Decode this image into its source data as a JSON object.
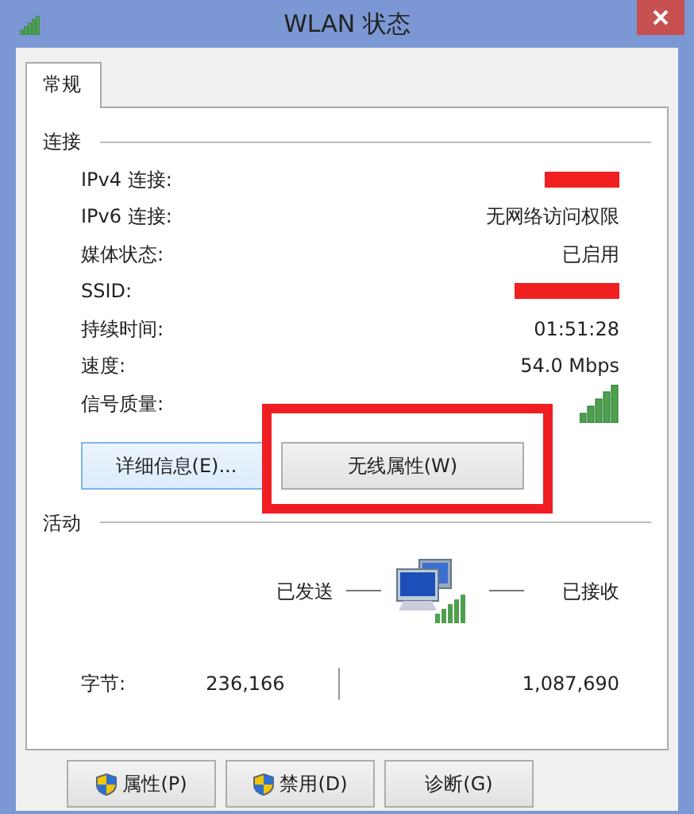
{
  "window": {
    "title": "WLAN 状态"
  },
  "tabs": [
    {
      "label": "常规",
      "selected": true
    }
  ],
  "connection": {
    "heading": "连接",
    "rows": [
      {
        "label": "IPv4 连接:",
        "kind": "redacted"
      },
      {
        "label": "IPv6 连接:",
        "kind": "text",
        "value": "无网络访问权限"
      },
      {
        "label": "媒体状态:",
        "kind": "text",
        "value": "已启用"
      },
      {
        "label": "SSID:",
        "kind": "redacted"
      },
      {
        "label": "持续时间:",
        "kind": "text",
        "value": "01:51:28"
      },
      {
        "label": "速度:",
        "kind": "text",
        "value": "54.0 Mbps"
      },
      {
        "label": "信号质量:",
        "kind": "signal"
      }
    ]
  },
  "connection_buttons": [
    {
      "label": "详细信息(E)...",
      "focused": true,
      "highlighted": false
    },
    {
      "label": "无线属性(W)",
      "focused": false,
      "highlighted": true
    }
  ],
  "activity": {
    "heading": "活动",
    "sent_label": "已发送",
    "received_label": "已接收",
    "bytes_label": "字节:",
    "bytes_sent": "236,166",
    "bytes_received": "1,087,690"
  },
  "buttons": [
    {
      "label": "属性(P)",
      "shield": true
    },
    {
      "label": "禁用(D)",
      "shield": true
    },
    {
      "label": "诊断(G)",
      "shield": false
    }
  ]
}
